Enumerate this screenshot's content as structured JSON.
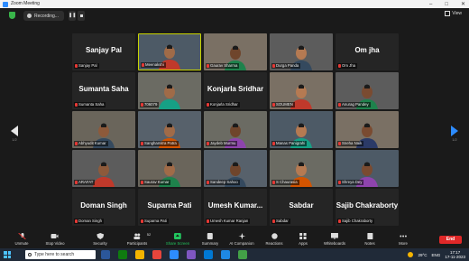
{
  "window": {
    "title": "Zoom Meeting"
  },
  "top": {
    "recording_label": "Recording...",
    "view_label": "View"
  },
  "pager": {
    "left": "1/2",
    "right": "1/2"
  },
  "participants": [
    {
      "name": "Sanjay Pal",
      "big": "Sanjay Pal",
      "video": false
    },
    {
      "name": "Meenakshi",
      "big": "",
      "video": true
    },
    {
      "name": "Gaurav Sharma",
      "big": "",
      "video": true
    },
    {
      "name": "Durga Panda",
      "big": "",
      "video": true
    },
    {
      "name": "Om Jha",
      "big": "Om jha",
      "video": false
    },
    {
      "name": "Sumanta Saha",
      "big": "Sumanta Saha",
      "video": false
    },
    {
      "name": "706079",
      "big": "",
      "video": true
    },
    {
      "name": "Konjarla Sridhar",
      "big": "Konjarla Sridhar",
      "video": false
    },
    {
      "name": "SOUMEN",
      "big": "",
      "video": true
    },
    {
      "name": "Anurag Pandey",
      "big": "",
      "video": true
    },
    {
      "name": "Abhyudit Kumar",
      "big": "",
      "video": true
    },
    {
      "name": "Sanghamitra Patra",
      "big": "",
      "video": true
    },
    {
      "name": "Jaydeb Murmu",
      "big": "",
      "video": true
    },
    {
      "name": "Manas Panigrahi",
      "big": "",
      "video": true
    },
    {
      "name": "Sneha Naik",
      "big": "",
      "video": true
    },
    {
      "name": "ARAFAT",
      "big": "",
      "video": true
    },
    {
      "name": "Saurav Kumar",
      "big": "",
      "video": true
    },
    {
      "name": "Sandeep Sahoo",
      "big": "",
      "video": true
    },
    {
      "name": "S Chaurasia",
      "big": "",
      "video": true
    },
    {
      "name": "Shreya Dey",
      "big": "",
      "video": true
    },
    {
      "name": "Doman Singh",
      "big": "Doman Singh",
      "video": false
    },
    {
      "name": "Suparna Pati",
      "big": "Suparna Pati",
      "video": false
    },
    {
      "name": "Umesh Kumar Ranjan",
      "big": "Umesh  Kumar...",
      "video": false
    },
    {
      "name": "Sabdar",
      "big": "Sabdar",
      "video": false
    },
    {
      "name": "Sajib Chakraborty",
      "big": "Sajib Chakraborty",
      "video": false
    }
  ],
  "toolbar": [
    {
      "label": "Unmute",
      "icon": "mic-muted-icon",
      "color": "#dddddd"
    },
    {
      "label": "Stop Video",
      "icon": "video-camera-icon",
      "color": "#dddddd"
    },
    {
      "label": "Security",
      "icon": "shield-icon",
      "color": "#dddddd"
    },
    {
      "label": "Participants",
      "icon": "participants-icon",
      "color": "#dddddd"
    },
    {
      "label": "Share Screen",
      "icon": "share-screen-icon",
      "color": "#22c55e"
    },
    {
      "label": "Summary",
      "icon": "summary-icon",
      "color": "#dddddd"
    },
    {
      "label": "AI Companion",
      "icon": "ai-sparkle-icon",
      "color": "#dddddd"
    },
    {
      "label": "Reactions",
      "icon": "reactions-icon",
      "color": "#dddddd"
    },
    {
      "label": "Apps",
      "icon": "apps-icon",
      "color": "#dddddd"
    },
    {
      "label": "Whiteboards",
      "icon": "whiteboard-icon",
      "color": "#dddddd"
    },
    {
      "label": "Notes",
      "icon": "notes-icon",
      "color": "#dddddd"
    },
    {
      "label": "More",
      "icon": "more-icon",
      "color": "#dddddd"
    }
  ],
  "participants_count": "52",
  "end_label": "End",
  "taskbar": {
    "search_placeholder": "Type here to search",
    "weather": "29°C",
    "lang": "ENG",
    "time": "17:17",
    "date": "17-11-2023"
  }
}
